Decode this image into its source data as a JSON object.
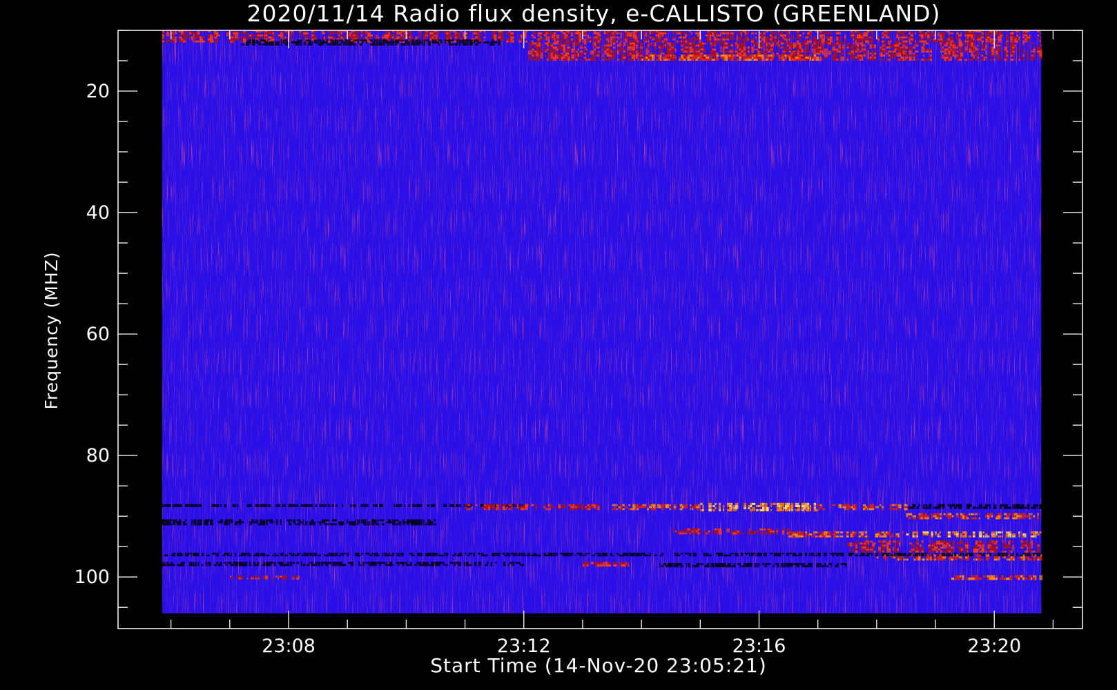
{
  "chart_data": {
    "type": "heatmap",
    "title": "2020/11/14  Radio flux density, e-CALLISTO (GREENLAND)",
    "xlabel": "Start Time (14-Nov-20 23:05:21)",
    "ylabel": "Frequency (MHZ)",
    "x_unit": "minutes after 23:00",
    "xlim": [
      5.1,
      21.5
    ],
    "data_x_range": [
      5.85,
      20.8
    ],
    "ylim": [
      108.5,
      10.0
    ],
    "data_y_range": [
      10.0,
      106.0
    ],
    "x_ticks": [
      {
        "value": 8,
        "label": "23:08"
      },
      {
        "value": 12,
        "label": "23:12"
      },
      {
        "value": 16,
        "label": "23:16"
      },
      {
        "value": 20,
        "label": "23:20"
      }
    ],
    "x_minor_step": 1,
    "y_ticks": [
      {
        "value": 20,
        "label": "20"
      },
      {
        "value": 40,
        "label": "40"
      },
      {
        "value": 60,
        "label": "60"
      },
      {
        "value": 80,
        "label": "80"
      },
      {
        "value": 100,
        "label": "100"
      }
    ],
    "y_minor_step": 5,
    "colormap": "blue-red-yellow",
    "background_color": "#2a10e6",
    "features": [
      {
        "kind": "emission",
        "t": [
          5.85,
          20.8
        ],
        "f": [
          10.0,
          12.0
        ],
        "level": "medium"
      },
      {
        "kind": "emission",
        "t": [
          12.0,
          20.8
        ],
        "f": [
          12.0,
          15.0
        ],
        "level": "medium"
      },
      {
        "kind": "emission",
        "t": [
          14.0,
          17.0
        ],
        "f": [
          14.0,
          15.0
        ],
        "level": "high"
      },
      {
        "kind": "dark",
        "t": [
          7.2,
          11.6
        ],
        "f": [
          11.5,
          12.5
        ],
        "level": "low"
      },
      {
        "kind": "dark",
        "t": [
          5.85,
          12.0
        ],
        "f": [
          88.0,
          88.5
        ],
        "level": "low"
      },
      {
        "kind": "dark",
        "t": [
          18.5,
          20.8
        ],
        "f": [
          88.0,
          88.8
        ],
        "level": "low"
      },
      {
        "kind": "emission",
        "t": [
          11.0,
          13.5
        ],
        "f": [
          88.0,
          89.0
        ],
        "level": "medium"
      },
      {
        "kind": "emission",
        "t": [
          13.5,
          15.0
        ],
        "f": [
          88.0,
          89.0
        ],
        "level": "high"
      },
      {
        "kind": "emission",
        "t": [
          15.0,
          17.0
        ],
        "f": [
          87.8,
          89.2
        ],
        "level": "very-high"
      },
      {
        "kind": "emission",
        "t": [
          17.0,
          18.5
        ],
        "f": [
          88.0,
          89.0
        ],
        "level": "high"
      },
      {
        "kind": "emission",
        "t": [
          18.5,
          20.8
        ],
        "f": [
          89.5,
          90.5
        ],
        "level": "high"
      },
      {
        "kind": "emission",
        "t": [
          14.5,
          16.5
        ],
        "f": [
          92.0,
          93.0
        ],
        "level": "medium"
      },
      {
        "kind": "emission",
        "t": [
          16.5,
          18.5
        ],
        "f": [
          92.5,
          93.5
        ],
        "level": "high"
      },
      {
        "kind": "emission",
        "t": [
          18.5,
          20.8
        ],
        "f": [
          92.5,
          93.5
        ],
        "level": "very-high"
      },
      {
        "kind": "emission",
        "t": [
          17.5,
          20.8
        ],
        "f": [
          94.0,
          96.0
        ],
        "level": "medium"
      },
      {
        "kind": "emission",
        "t": [
          18.0,
          20.8
        ],
        "f": [
          96.3,
          97.3
        ],
        "level": "high"
      },
      {
        "kind": "emission",
        "t": [
          13.0,
          13.8
        ],
        "f": [
          97.5,
          98.3
        ],
        "level": "medium"
      },
      {
        "kind": "emission",
        "t": [
          19.2,
          20.8
        ],
        "f": [
          99.7,
          100.5
        ],
        "level": "high"
      },
      {
        "kind": "emission",
        "t": [
          6.9,
          8.2
        ],
        "f": [
          99.8,
          100.4
        ],
        "level": "medium"
      },
      {
        "kind": "dark",
        "t": [
          5.85,
          10.5
        ],
        "f": [
          90.5,
          91.5
        ],
        "level": "low"
      },
      {
        "kind": "dark",
        "t": [
          5.85,
          12.0
        ],
        "f": [
          97.5,
          98.2
        ],
        "level": "low"
      },
      {
        "kind": "dark",
        "t": [
          14.3,
          17.5
        ],
        "f": [
          97.7,
          98.4
        ],
        "level": "low"
      },
      {
        "kind": "dark",
        "t": [
          5.85,
          20.8
        ],
        "f": [
          96.0,
          96.6
        ],
        "level": "low"
      }
    ]
  }
}
